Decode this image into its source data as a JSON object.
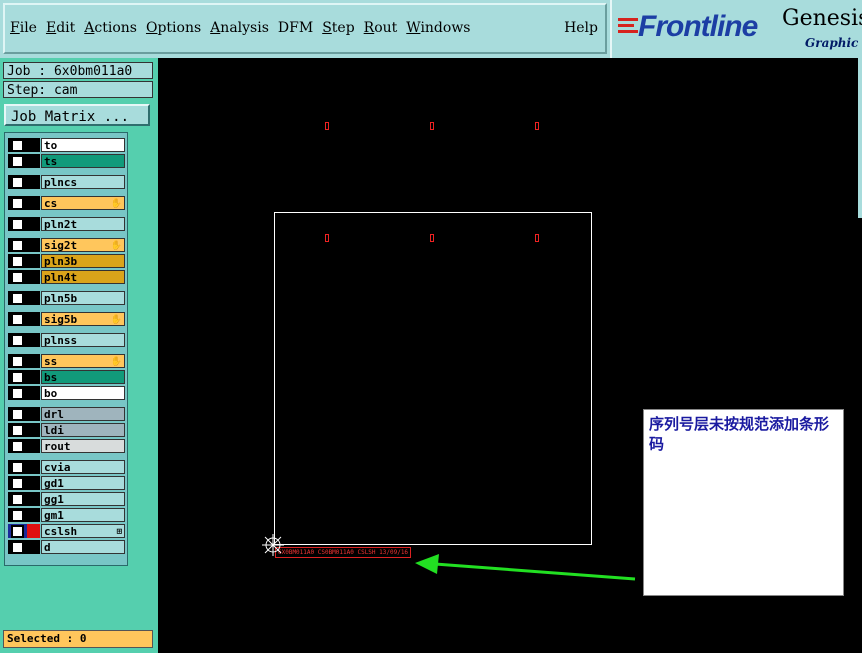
{
  "menubar": {
    "items": [
      "File",
      "Edit",
      "Actions",
      "Options",
      "Analysis",
      "DFM",
      "Step",
      "Rout",
      "Windows"
    ],
    "help": "Help"
  },
  "logo": {
    "brand": "Frontline",
    "product": "Genesis",
    "tagline": "Graphic E"
  },
  "info": {
    "job": "Job : 6x0bm011a0",
    "step": "Step: cam"
  },
  "job_matrix_label": "Job Matrix ...",
  "layers": [
    {
      "name": "to",
      "color": "#ffffff"
    },
    {
      "name": "ts",
      "color": "#119a7a"
    },
    {
      "name": "plncs",
      "color": "#a8dcdc"
    },
    {
      "name": "cs",
      "color": "#ffc65c",
      "mark": true
    },
    {
      "name": "pln2t",
      "color": "#a8dcdc"
    },
    {
      "name": "sig2t",
      "color": "#ffc65c",
      "mark": true
    },
    {
      "name": "pln3b",
      "color": "#daa41a"
    },
    {
      "name": "pln4t",
      "color": "#daa41a"
    },
    {
      "name": "pln5b",
      "color": "#a8dcdc"
    },
    {
      "name": "sig5b",
      "color": "#ffc65c",
      "mark": true
    },
    {
      "name": "plnss",
      "color": "#a8dcdc"
    },
    {
      "name": "ss",
      "color": "#ffc65c",
      "mark": true
    },
    {
      "name": "bs",
      "color": "#119a7a"
    },
    {
      "name": "bo",
      "color": "#ffffff"
    },
    {
      "name": "drl",
      "color": "#9fb4bd"
    },
    {
      "name": "ldi",
      "color": "#9fb4bd"
    },
    {
      "name": "rout",
      "color": "#d8dcdc"
    },
    {
      "name": "cvia",
      "color": "#a8dcdc"
    },
    {
      "name": "gd1",
      "color": "#a8dcdc"
    },
    {
      "name": "gg1",
      "color": "#a8dcdc"
    },
    {
      "name": "gm1",
      "color": "#a8dcdc"
    },
    {
      "name": "cslsh",
      "color": "#a8dcdc",
      "active": true,
      "extra": true
    },
    {
      "name": "d",
      "color": "#a8dcdc"
    }
  ],
  "selected_label": "Selected : 0",
  "canvas": {
    "barcode_text": "6X0BM011A0 CS0BM011A0 CSLSH 13/09/16 14:30",
    "note": "序列号层未按规范添加条形码",
    "accent_red": "#e02020",
    "arrow_color": "#22e022"
  }
}
